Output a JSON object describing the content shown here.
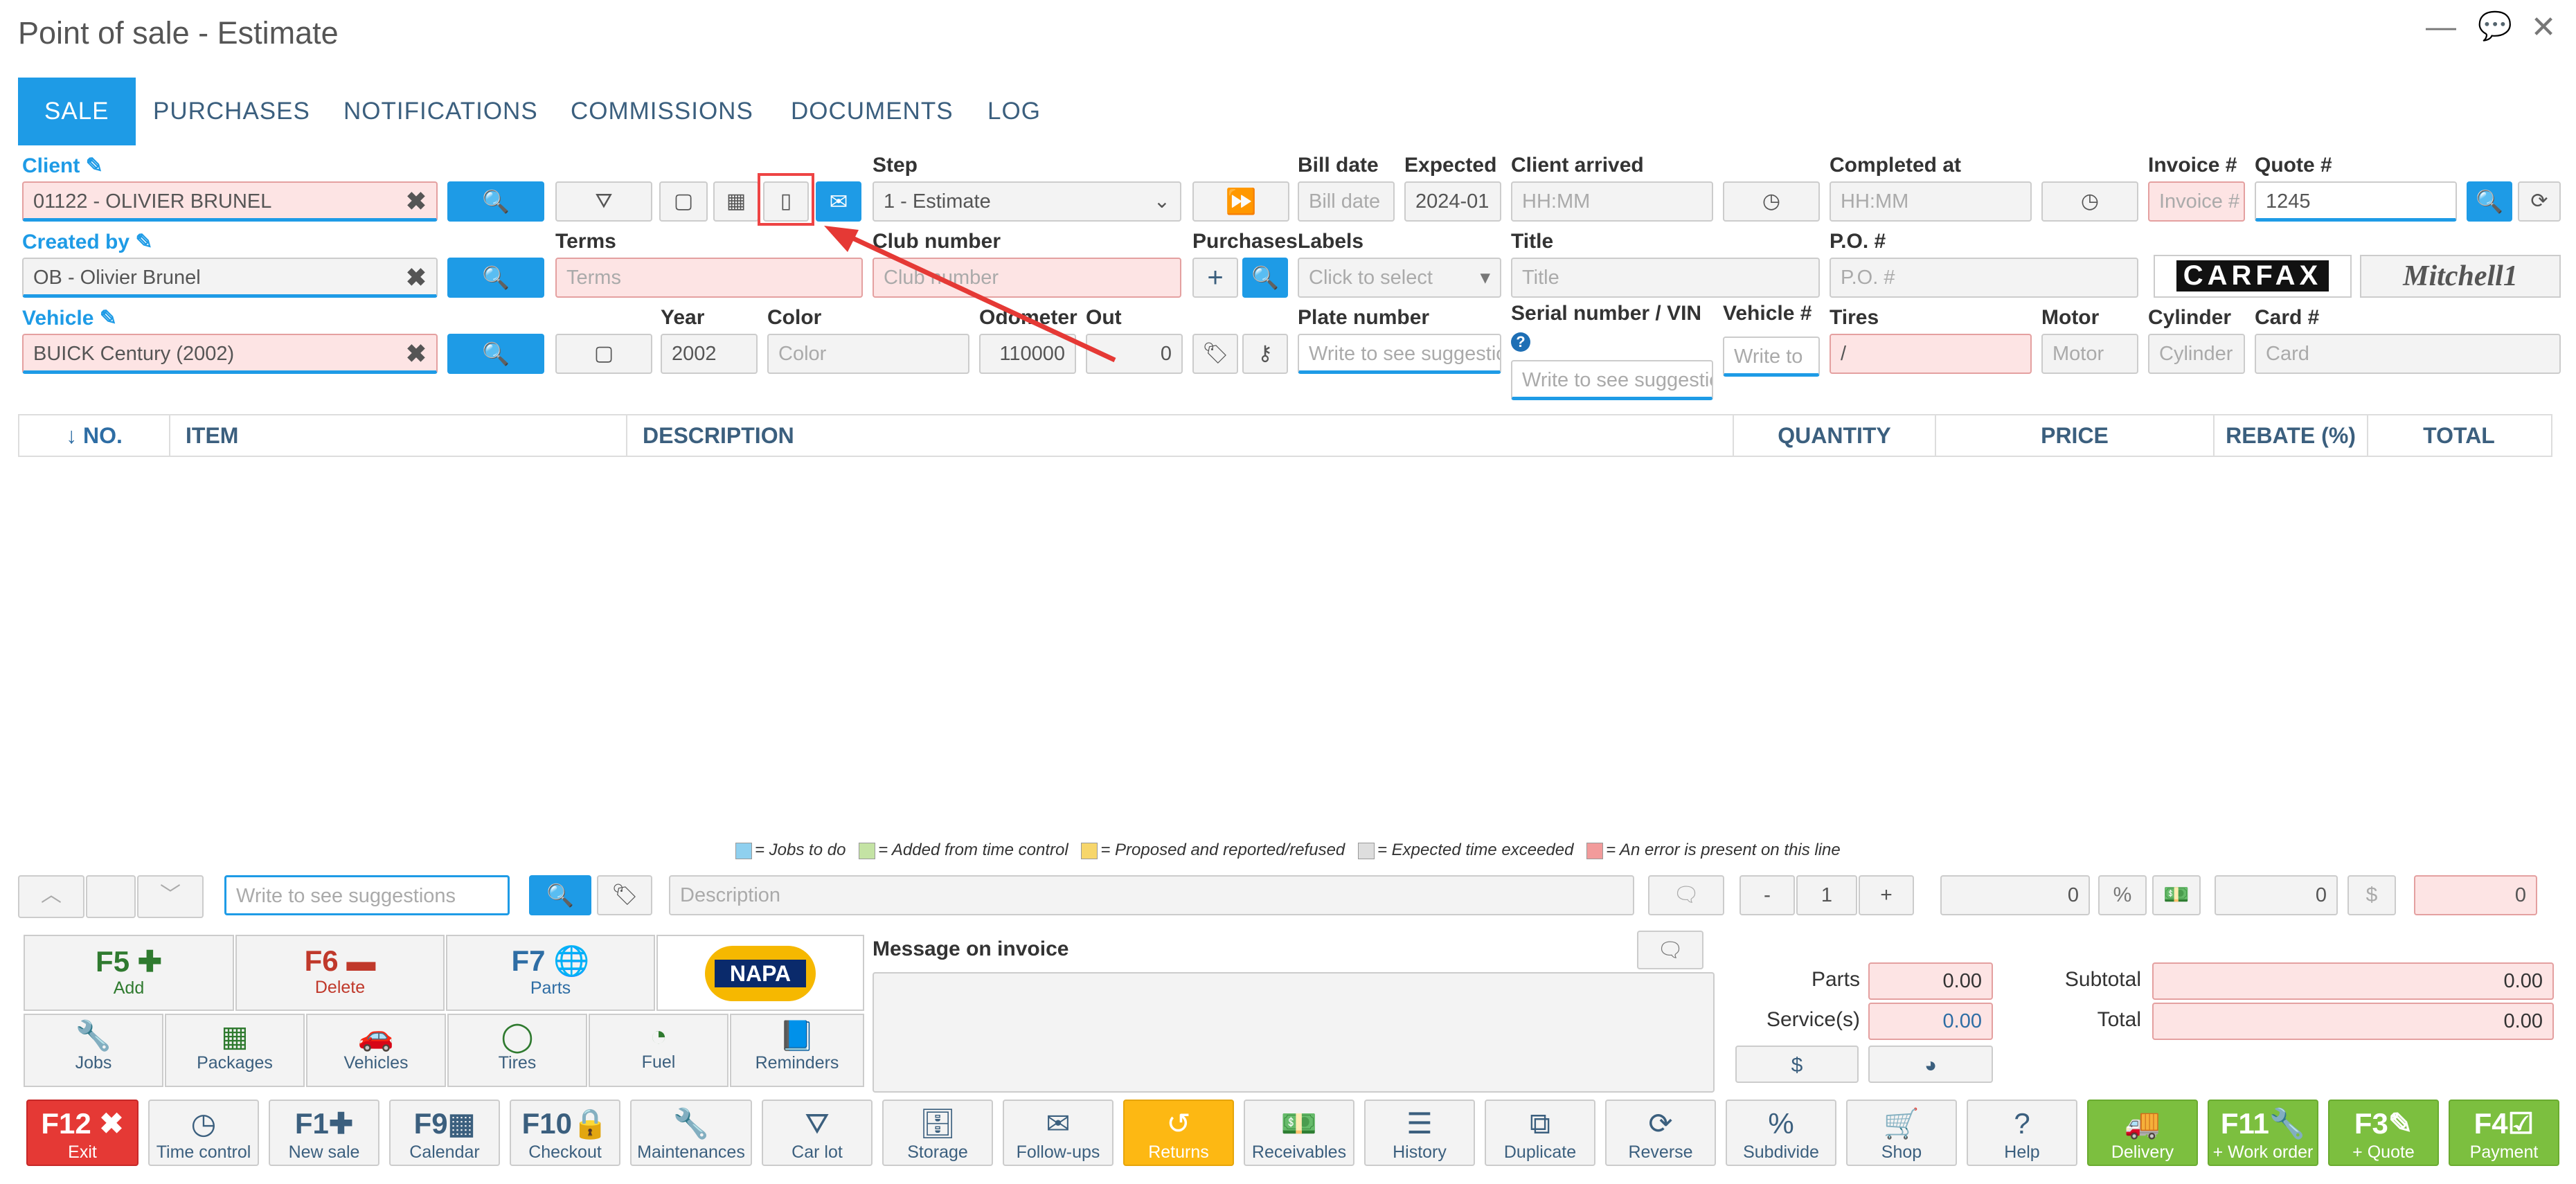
{
  "window": {
    "title": "Point of sale - Estimate"
  },
  "tabs": [
    "SALE",
    "PURCHASES",
    "NOTIFICATIONS",
    "COMMISSIONS",
    "DOCUMENTS",
    "LOG"
  ],
  "form": {
    "client_label": "Client",
    "client_value": "01122 - OLIVIER BRUNEL",
    "created_by_label": "Created by",
    "created_by_value": "OB - Olivier Brunel",
    "vehicle_label": "Vehicle",
    "vehicle_value": "BUICK Century (2002)",
    "terms_label": "Terms",
    "terms_ph": "Terms",
    "step_label": "Step",
    "step_value": "1 - Estimate",
    "club_label": "Club number",
    "club_ph": "Club number",
    "purchases_label": "Purchases",
    "bill_date_label": "Bill date",
    "bill_date_ph": "Bill date",
    "expected_label": "Expected",
    "expected_value": "2024-01",
    "client_arrived_label": "Client arrived",
    "client_arrived_ph": "HH:MM",
    "completed_label": "Completed at",
    "completed_ph": "HH:MM",
    "invoice_label": "Invoice #",
    "invoice_ph": "Invoice #",
    "quote_label": "Quote #",
    "quote_value": "1245",
    "labels_label": "Labels",
    "labels_ph": "Click to select",
    "title_label": "Title",
    "title_ph": "Title",
    "po_label": "P.O. #",
    "po_ph": "P.O. #",
    "year_label": "Year",
    "year_value": "2002",
    "color_label": "Color",
    "color_ph": "Color",
    "odometer_label": "Odometer",
    "odometer_value": "110000",
    "out_label": "Out",
    "out_value": "0",
    "plate_label": "Plate number",
    "plate_ph": "Write to see suggestions",
    "vin_label": "Serial number / VIN",
    "vin_ph": "Write to see suggestions",
    "vehno_label": "Vehicle #",
    "vehno_ph": "Write to",
    "tires_label": "Tires",
    "tires_value": "/",
    "motor_label": "Motor",
    "motor_ph": "Motor",
    "cylinder_label": "Cylinder",
    "cylinder_ph": "Cylinder",
    "card_label": "Card #",
    "card_ph": "Card",
    "carfax": "CARFAX",
    "mitchell": "Mitchell1"
  },
  "table": {
    "headers": [
      "↓ NO.",
      "ITEM",
      "DESCRIPTION",
      "QUANTITY",
      "PRICE",
      "REBATE (%)",
      "TOTAL"
    ]
  },
  "legend": [
    "= Jobs to do",
    "= Added from time control",
    "= Proposed and reported/refused",
    "= Expected time exceeded",
    "= An error is present on this line"
  ],
  "legend_colors": [
    "#8fd0ef",
    "#c4e3a4",
    "#f7d66b",
    "#dedede",
    "#f29b9b"
  ],
  "entry": {
    "suggest_ph": "Write to see suggestions",
    "desc_ph": "Description",
    "minus": "-",
    "qty": "1",
    "plus": "+",
    "price": "0",
    "discount": "0",
    "total": "0"
  },
  "fkeys": [
    {
      "k": "F5",
      "s": "Add",
      "color": "#2f7a2f"
    },
    {
      "k": "F6",
      "s": "Delete",
      "color": "#c0392b"
    },
    {
      "k": "F7",
      "s": "Parts",
      "color": "#2e6da4"
    }
  ],
  "napa": "NAPA",
  "cats": [
    "Jobs",
    "Packages",
    "Vehicles",
    "Tires",
    "Fuel",
    "Reminders"
  ],
  "message": {
    "label": "Message on invoice"
  },
  "totals": {
    "parts_label": "Parts",
    "parts": "0.00",
    "service_label": "Service(s)",
    "service": "0.00",
    "subtotal_label": "Subtotal",
    "subtotal": "0.00",
    "total_label": "Total",
    "total": "0.00"
  },
  "bottom": [
    {
      "fn": "F12",
      "s": "Exit"
    },
    {
      "s": "Time control"
    },
    {
      "fn": "F1",
      "s": "New sale"
    },
    {
      "fn": "F9",
      "s": "Calendar"
    },
    {
      "fn": "F10",
      "s": "Checkout"
    },
    {
      "s": "Maintenances"
    },
    {
      "s": "Car lot"
    },
    {
      "s": "Storage"
    },
    {
      "s": "Follow-ups"
    },
    {
      "s": "Returns"
    },
    {
      "s": "Receivables"
    },
    {
      "s": "History"
    },
    {
      "s": "Duplicate"
    },
    {
      "s": "Reverse"
    },
    {
      "s": "Subdivide"
    },
    {
      "s": "Shop"
    },
    {
      "s": "Help"
    },
    {
      "s": "Delivery"
    },
    {
      "fn": "F11",
      "s": "+ Work order"
    },
    {
      "fn": "F3",
      "s": "+ Quote"
    },
    {
      "fn": "F4",
      "s": "Payment"
    }
  ]
}
